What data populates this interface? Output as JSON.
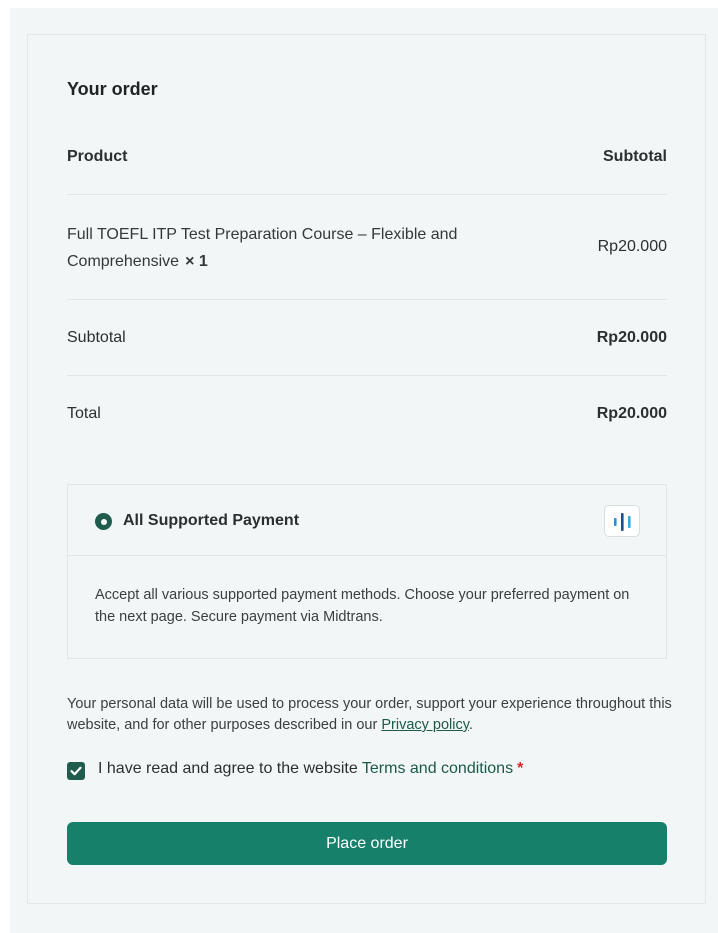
{
  "order": {
    "title": "Your order",
    "product_header": "Product",
    "subtotal_header": "Subtotal",
    "items": [
      {
        "name": "Full TOEFL ITP Test Preparation Course – Flexible and Comprehensive",
        "quantity": "× 1",
        "subtotal": "Rp20.000"
      }
    ],
    "subtotal_label": "Subtotal",
    "subtotal_value": "Rp20.000",
    "total_label": "Total",
    "total_value": "Rp20.000"
  },
  "payment": {
    "method_label": "All Supported Payment",
    "logo_icon": "midtrans-logo-icon",
    "description": "Accept all various supported payment methods. Choose your preferred payment on the next page. Secure payment via Midtrans.",
    "selected": true
  },
  "privacy": {
    "text": "Your personal data will be used to process your order, support your experience throughout this website, and for other purposes described in our ",
    "link_label": "Privacy policy",
    "suffix": "."
  },
  "terms": {
    "checked": true,
    "text": "I have read and agree to the website ",
    "link_label": "Terms and conditions",
    "required_mark": "*"
  },
  "actions": {
    "place_order_label": "Place order"
  },
  "colors": {
    "accent": "#17806a",
    "dark_green": "#1f5c4d",
    "link": "#1b5a48",
    "required": "#d62828",
    "background": "#f3f6f6"
  }
}
